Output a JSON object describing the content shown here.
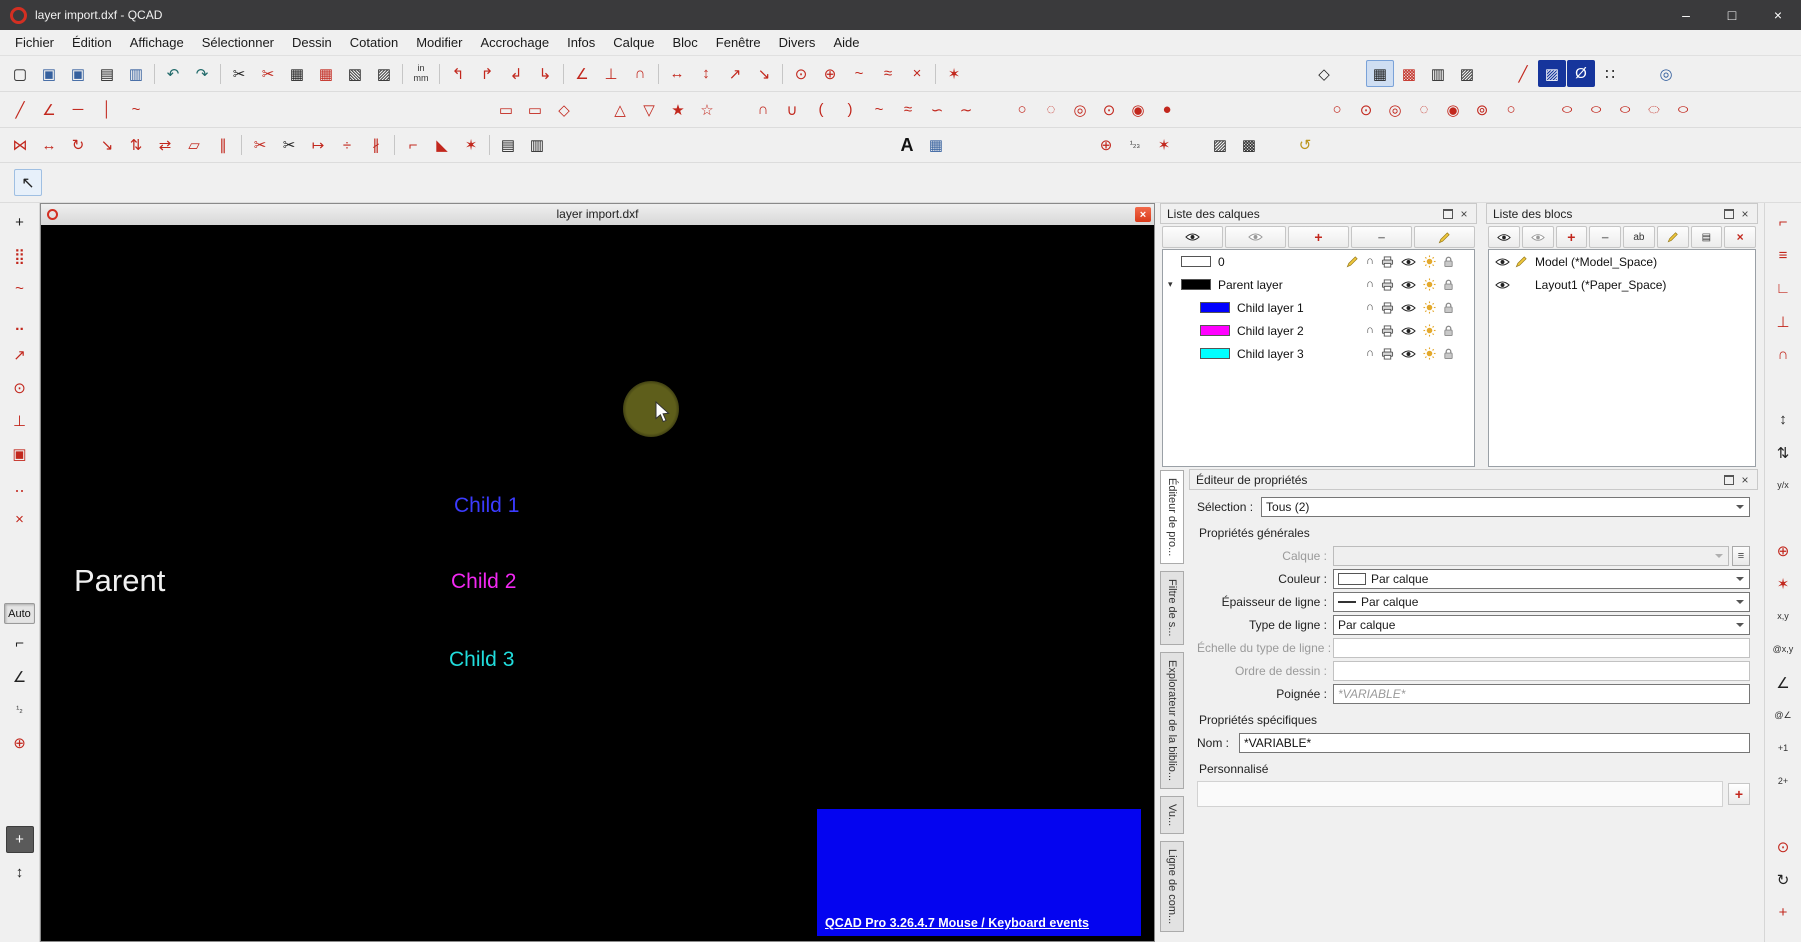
{
  "theme": {
    "parent_color": "#f0f0f0",
    "child1_color": "#3b3bff",
    "child2_color": "#f228f2",
    "child3_color": "#21dcdc",
    "banner_bg": "#0404f0",
    "accent_red": "#c2271d",
    "selected_navy": "#16359c",
    "snap_circle": "#5e5e1b"
  },
  "titlebar": {
    "title": "layer import.dxf - QCAD",
    "minimize": "–",
    "maximize": "□",
    "close": "×"
  },
  "chrome": {
    "close": "×"
  },
  "menubar": {
    "items": [
      "Fichier",
      "Édition",
      "Affichage",
      "Sélectionner",
      "Dessin",
      "Cotation",
      "Modifier",
      "Accrochage",
      "Infos",
      "Calque",
      "Bloc",
      "Fenêtre",
      "Divers",
      "Aide"
    ]
  },
  "toolbars": {
    "row1": [
      {
        "n": "new-file",
        "g": "▢",
        "c": "k"
      },
      {
        "n": "open-file",
        "g": "▣",
        "c": "b"
      },
      {
        "n": "save-file",
        "g": "▣",
        "c": "b"
      },
      {
        "n": "print",
        "g": "▤",
        "c": "k"
      },
      {
        "n": "print-preview",
        "g": "▥",
        "c": "b"
      },
      {
        "n": "separator",
        "g": "",
        "c": "sep"
      },
      {
        "n": "undo",
        "g": "↶",
        "c": "t"
      },
      {
        "n": "redo",
        "g": "↷",
        "c": "t"
      },
      {
        "n": "separator",
        "g": "",
        "c": "sep"
      },
      {
        "n": "cut",
        "g": "✂",
        "c": "k"
      },
      {
        "n": "cut-with-reference",
        "g": "✂",
        "c": "r"
      },
      {
        "n": "copy",
        "g": "▦",
        "c": "k"
      },
      {
        "n": "copy-with-reference",
        "g": "▦",
        "c": "r"
      },
      {
        "n": "paste",
        "g": "▧",
        "c": "k"
      },
      {
        "n": "paste-along-entity",
        "g": "▨",
        "c": "k"
      },
      {
        "n": "separator",
        "g": "",
        "c": "sep"
      },
      {
        "n": "drawing-unit",
        "g": "in\nmm",
        "c": "txt"
      },
      {
        "n": "separator",
        "g": "",
        "c": "sep"
      },
      {
        "n": "draw-order-front",
        "g": "↰",
        "c": "r"
      },
      {
        "n": "draw-order-back",
        "g": "↱",
        "c": "r"
      },
      {
        "n": "draw-order-raise",
        "g": "↲",
        "c": "r"
      },
      {
        "n": "draw-order-lower",
        "g": "↳",
        "c": "r"
      },
      {
        "n": "separator",
        "g": "",
        "c": "sep"
      },
      {
        "n": "angle-tool",
        "g": "∠",
        "c": "r"
      },
      {
        "n": "perpendicular-tool",
        "g": "⊥",
        "c": "r"
      },
      {
        "n": "arc-join-tool",
        "g": "∩",
        "c": "r"
      },
      {
        "n": "separator",
        "g": "",
        "c": "sep"
      },
      {
        "n": "move-horizontal-tool",
        "g": "↔",
        "c": "r"
      },
      {
        "n": "move-vertical-tool",
        "g": "↕",
        "c": "r"
      },
      {
        "n": "diagonal-tool-up",
        "g": "↗",
        "c": "r"
      },
      {
        "n": "diagonal-tool-down",
        "g": "↘",
        "c": "r"
      },
      {
        "n": "separator",
        "g": "",
        "c": "sep"
      },
      {
        "n": "center-snap-tool",
        "g": "⊙",
        "c": "r"
      },
      {
        "n": "reference-snap-tool",
        "g": "⊕",
        "c": "r"
      },
      {
        "n": "curve-tool",
        "g": "~",
        "c": "r"
      },
      {
        "n": "spline-tool",
        "g": "≈",
        "c": "r"
      },
      {
        "n": "intersection-tool",
        "g": "×",
        "c": "r"
      },
      {
        "n": "separator",
        "g": "",
        "c": "sep"
      },
      {
        "n": "snap-star-tool",
        "g": "✶",
        "c": "r"
      },
      {
        "n": "gap",
        "g": "",
        "c": "gapl"
      },
      {
        "n": "isometric-projection",
        "g": "◇",
        "c": "k"
      },
      {
        "n": "gap",
        "g": "",
        "c": "gaps"
      },
      {
        "n": "grid-toggle",
        "g": "▦",
        "c": "hl"
      },
      {
        "n": "hatch-pattern-1",
        "g": "▩",
        "c": "r"
      },
      {
        "n": "hatch-pattern-2",
        "g": "▥",
        "c": "k"
      },
      {
        "n": "hatch-pattern-3",
        "g": "▨",
        "c": "k"
      },
      {
        "n": "gap",
        "g": "",
        "c": "gaps"
      },
      {
        "n": "pen-settings",
        "g": "╱",
        "c": "r"
      },
      {
        "n": "draft-mode-toggle",
        "g": "▨",
        "c": "sel"
      },
      {
        "n": "linetype-display-toggle",
        "g": "Ø",
        "c": "sel"
      },
      {
        "n": "point-display",
        "g": "∷",
        "c": "k"
      },
      {
        "n": "gap",
        "g": "",
        "c": "gaps"
      },
      {
        "n": "zoom-tools",
        "g": "◎",
        "c": "b"
      }
    ],
    "row2": [
      {
        "n": "line-2-points",
        "g": "╱",
        "c": "r"
      },
      {
        "n": "line-angle",
        "g": "∠",
        "c": "r"
      },
      {
        "n": "line-horizontal",
        "g": "─",
        "c": "r"
      },
      {
        "n": "line-vertical",
        "g": "│",
        "c": "r"
      },
      {
        "n": "line-freehand",
        "g": "~",
        "c": "r"
      },
      {
        "n": "gap",
        "g": "",
        "c": "gapl"
      },
      {
        "n": "rectangle-2-points",
        "g": "▭",
        "c": "r"
      },
      {
        "n": "rectangle-size",
        "g": "▭",
        "c": "r"
      },
      {
        "n": "rectangle-3-points",
        "g": "◇",
        "c": "r"
      },
      {
        "n": "gap",
        "g": "",
        "c": "gaps"
      },
      {
        "n": "polygon-center-corner",
        "g": "△",
        "c": "r"
      },
      {
        "n": "polygon-2-corners",
        "g": "▽",
        "c": "r"
      },
      {
        "n": "polygon-side",
        "g": "★",
        "c": "r"
      },
      {
        "n": "star-shape",
        "g": "☆",
        "c": "r"
      },
      {
        "n": "gap",
        "g": "",
        "c": "gaps"
      },
      {
        "n": "arc-center-point",
        "g": "∩",
        "c": "r"
      },
      {
        "n": "arc-3-points",
        "g": "∪",
        "c": "r"
      },
      {
        "n": "arc-2-points-radius",
        "g": "(",
        "c": "r"
      },
      {
        "n": "arc-2-points-angle",
        "g": ")",
        "c": "r"
      },
      {
        "n": "arc-tangent",
        "g": "~",
        "c": "r"
      },
      {
        "n": "arc-concentric",
        "g": "≈",
        "c": "r"
      },
      {
        "n": "spline-control-points",
        "g": "∽",
        "c": "r"
      },
      {
        "n": "spline-fit-points",
        "g": "∼",
        "c": "r"
      },
      {
        "n": "gap",
        "g": "",
        "c": "gaps"
      },
      {
        "n": "circle-center-point",
        "g": "○",
        "c": "r"
      },
      {
        "n": "circle-2-points",
        "g": "◌",
        "c": "r"
      },
      {
        "n": "circle-3-points",
        "g": "◎",
        "c": "r"
      },
      {
        "n": "circle-center-radius",
        "g": "⊙",
        "c": "r"
      },
      {
        "n": "circle-concentric",
        "g": "◉",
        "c": "r"
      },
      {
        "n": "circle-tangent",
        "g": "●",
        "c": "r"
      },
      {
        "n": "gap",
        "g": "",
        "c": "gapm"
      },
      {
        "n": "circle-tools-1",
        "g": "○",
        "c": "r"
      },
      {
        "n": "circle-tools-2",
        "g": "⊙",
        "c": "r"
      },
      {
        "n": "circle-tools-3",
        "g": "◎",
        "c": "r"
      },
      {
        "n": "circle-tools-4",
        "g": "◌",
        "c": "r"
      },
      {
        "n": "circle-tools-5",
        "g": "◉",
        "c": "r"
      },
      {
        "n": "circle-tools-6",
        "g": "⊚",
        "c": "r"
      },
      {
        "n": "circle-tools-7",
        "g": "○",
        "c": "r"
      },
      {
        "n": "gap",
        "g": "",
        "c": "gaps"
      },
      {
        "n": "ellipse-center-point",
        "g": "○",
        "c": "rw"
      },
      {
        "n": "ellipse-axes",
        "g": "○",
        "c": "rw"
      },
      {
        "n": "ellipse-quadrant",
        "g": "○",
        "c": "rw"
      },
      {
        "n": "ellipse-arc",
        "g": "◌",
        "c": "rw"
      },
      {
        "n": "ellipse-inscribed",
        "g": "○",
        "c": "rw"
      }
    ],
    "row3": [
      {
        "n": "modify-mirror",
        "g": "⋈",
        "c": "r"
      },
      {
        "n": "modify-move",
        "g": "↔",
        "c": "r"
      },
      {
        "n": "modify-rotate",
        "g": "↻",
        "c": "r"
      },
      {
        "n": "modify-scale",
        "g": "↘",
        "c": "r"
      },
      {
        "n": "modify-stretch",
        "g": "⇅",
        "c": "r"
      },
      {
        "n": "modify-flip",
        "g": "⇄",
        "c": "r"
      },
      {
        "n": "modify-skew",
        "g": "▱",
        "c": "r"
      },
      {
        "n": "modify-offset",
        "g": "∥",
        "c": "r"
      },
      {
        "n": "separator",
        "g": "",
        "c": "sep"
      },
      {
        "n": "modify-trim",
        "g": "✂",
        "c": "r"
      },
      {
        "n": "modify-trim-both",
        "g": "✂",
        "c": "k"
      },
      {
        "n": "modify-lengthen",
        "g": "↦",
        "c": "r"
      },
      {
        "n": "modify-divide",
        "g": "÷",
        "c": "r"
      },
      {
        "n": "modify-break-out",
        "g": "∦",
        "c": "r"
      },
      {
        "n": "separator",
        "g": "",
        "c": "sep"
      },
      {
        "n": "modify-round",
        "g": "⌐",
        "c": "r"
      },
      {
        "n": "modify-bevel",
        "g": "◣",
        "c": "r"
      },
      {
        "n": "modify-explode",
        "g": "✶",
        "c": "r"
      },
      {
        "n": "separator",
        "g": "",
        "c": "sep"
      },
      {
        "n": "hatch-create",
        "g": "▤",
        "c": "k"
      },
      {
        "n": "hatch-edit",
        "g": "▥",
        "c": "k"
      },
      {
        "n": "gap",
        "g": "",
        "c": "gapl"
      },
      {
        "n": "text-tool",
        "g": "A",
        "c": "kb"
      },
      {
        "n": "image-insert",
        "g": "▦",
        "c": "b"
      },
      {
        "n": "gap",
        "g": "",
        "c": "gapm"
      },
      {
        "n": "point-coordinate",
        "g": "⊕",
        "c": "r"
      },
      {
        "n": "point-sequence",
        "g": "¹₂₃",
        "c": "txt"
      },
      {
        "n": "pattern-star",
        "g": "✶",
        "c": "r"
      },
      {
        "n": "gap",
        "g": "",
        "c": "gaps"
      },
      {
        "n": "hatch-pattern",
        "g": "▨",
        "c": "k"
      },
      {
        "n": "hatch-solid",
        "g": "▩",
        "c": "k"
      },
      {
        "n": "gap",
        "g": "",
        "c": "gaps"
      },
      {
        "n": "reset-relative-zero",
        "g": "↺",
        "c": "y"
      }
    ],
    "row4": [
      {
        "n": "selection-pointer",
        "g": "↖",
        "c": "ptr"
      }
    ],
    "left": [
      {
        "n": "snap-free",
        "g": "+",
        "c": "k"
      },
      {
        "n": "snap-grid",
        "g": "⣿",
        "c": "r"
      },
      {
        "n": "snap-on-entity",
        "g": "~",
        "c": "r"
      },
      {
        "n": "snap-end-points",
        "g": "⣀",
        "c": "r"
      },
      {
        "n": "snap-tangential",
        "g": "↗",
        "c": "r"
      },
      {
        "n": "snap-center",
        "g": "⊙",
        "c": "r"
      },
      {
        "n": "snap-perpendicular",
        "g": "⊥",
        "c": "r"
      },
      {
        "n": "snap-reference",
        "g": "▣",
        "c": "r"
      },
      {
        "n": "snap-distance",
        "g": "‥",
        "c": "r"
      },
      {
        "n": "snap-intersection",
        "g": "×",
        "c": "r"
      },
      {
        "n": "spacer",
        "g": "",
        "c": "sp"
      },
      {
        "n": "spacer",
        "g": "",
        "c": "sp"
      },
      {
        "n": "snap-auto-button",
        "g": "Auto",
        "c": "auto"
      },
      {
        "n": "coordinate-cartesian",
        "g": "⌐",
        "c": "k"
      },
      {
        "n": "coordinate-polar",
        "g": "∠",
        "c": "k"
      },
      {
        "n": "coordinate-sequence",
        "g": "¹₂",
        "c": "txt"
      },
      {
        "n": "snap-coordinate",
        "g": "⊕",
        "c": "r"
      },
      {
        "n": "spacer",
        "g": "",
        "c": "sp"
      },
      {
        "n": "spacer",
        "g": "",
        "c": "sp"
      },
      {
        "n": "add-point",
        "g": "+",
        "c": "dark"
      },
      {
        "n": "restrict-orthogonal",
        "g": "↕",
        "c": "k"
      }
    ],
    "right": [
      {
        "n": "polyline-tools",
        "g": "⌐",
        "c": "r"
      },
      {
        "n": "offset-tools",
        "g": "≡",
        "c": "r"
      },
      {
        "n": "corner-tools",
        "g": "∟",
        "c": "r"
      },
      {
        "n": "perpendicular-tools",
        "g": "⊥",
        "c": "r"
      },
      {
        "n": "arc-tools",
        "g": "∩",
        "c": "r"
      },
      {
        "n": "spacer",
        "g": "",
        "c": "sp"
      },
      {
        "n": "vertical-measure",
        "g": "↕",
        "c": "k"
      },
      {
        "n": "dual-measure",
        "g": "⇅",
        "c": "k"
      },
      {
        "n": "axis-reference",
        "g": "y/x",
        "c": "txt"
      },
      {
        "n": "spacer",
        "g": "",
        "c": "sp"
      },
      {
        "n": "coordinate-point-tool",
        "g": "⊕",
        "c": "r"
      },
      {
        "n": "reference-star-tool",
        "g": "✶",
        "c": "r"
      },
      {
        "n": "absolute-coordinate",
        "g": "x,y",
        "c": "txt"
      },
      {
        "n": "relative-coordinate",
        "g": "@x,y",
        "c": "txt"
      },
      {
        "n": "polar-angle",
        "g": "∠",
        "c": "k"
      },
      {
        "n": "relative-polar",
        "g": "@∠",
        "c": "txt"
      },
      {
        "n": "increment-one",
        "g": "+1",
        "c": "txt"
      },
      {
        "n": "increment-two",
        "g": "2+",
        "c": "txt"
      },
      {
        "n": "spacer",
        "g": "",
        "c": "sp"
      },
      {
        "n": "center-mark-tool",
        "g": "⊙",
        "c": "r"
      },
      {
        "n": "rotate-view-tool",
        "g": "↻",
        "c": "k"
      },
      {
        "n": "add-tool",
        "g": "+",
        "c": "r"
      }
    ]
  },
  "mdi": {
    "doc_title": "layer import.dxf",
    "texts": {
      "parent": "Parent",
      "child1": "Child 1",
      "child2": "Child 2",
      "child3": "Child 3"
    },
    "banner_link": "QCAD Pro 3.26.4.7  Mouse / Keyboard events"
  },
  "layers_panel": {
    "title": "Liste des calques",
    "toolbar_glyphs": {
      "add": "+",
      "remove": "−"
    },
    "rows": [
      {
        "name": "0",
        "color": "#ffffff",
        "indent": 0,
        "arrow": "",
        "current": true
      },
      {
        "name": "Parent layer",
        "color": "#000000",
        "indent": 0,
        "arrow": "▾",
        "current": false
      },
      {
        "name": "Child layer 1",
        "color": "#0000ff",
        "indent": 1,
        "arrow": "",
        "current": false
      },
      {
        "name": "Child layer 2",
        "color": "#ff00ff",
        "indent": 1,
        "arrow": "",
        "current": false
      },
      {
        "name": "Child layer 3",
        "color": "#00ffff",
        "indent": 1,
        "arrow": "",
        "current": false
      }
    ]
  },
  "blocks_panel": {
    "title": "Liste des blocs",
    "toolbar_glyphs": {
      "add": "+",
      "remove": "−",
      "rename": "ab",
      "misc": "▤",
      "close": "×"
    },
    "rows": [
      {
        "name": "Model (*Model_Space)",
        "current": true
      },
      {
        "name": "Layout1 (*Paper_Space)",
        "current": false
      }
    ]
  },
  "property_editor": {
    "title": "Éditeur de propriétés",
    "selection_label": "Sélection :",
    "selection_value": "Tous (2)",
    "calque_button": "≡",
    "add_custom": "+",
    "sections": {
      "general": "Propriétés générales",
      "specific": "Propriétés spécifiques",
      "custom": "Personnalisé"
    },
    "fields": {
      "calque": {
        "label": "Calque :",
        "value": ""
      },
      "couleur": {
        "label": "Couleur :",
        "value": "Par calque"
      },
      "epaisseur": {
        "label": "Épaisseur de ligne :",
        "value": "Par calque"
      },
      "type_ligne": {
        "label": "Type de ligne :",
        "value": "Par calque"
      },
      "echelle": {
        "label": "Échelle du type de ligne :",
        "value": ""
      },
      "ordre": {
        "label": "Ordre de dessin :",
        "value": ""
      },
      "poignee": {
        "label": "Poignée :",
        "value": "*VARIABLE*"
      },
      "nom": {
        "label": "Nom :",
        "value": "*VARIABLE*"
      }
    }
  },
  "side_tabs": [
    {
      "label": "Éditeur de pro...",
      "active": true
    },
    {
      "label": "Filtre de s...",
      "active": false
    },
    {
      "label": "Explorateur de la biblio...",
      "active": false
    },
    {
      "label": "Vu...",
      "active": false
    },
    {
      "label": "Ligne de com...",
      "active": false
    }
  ]
}
